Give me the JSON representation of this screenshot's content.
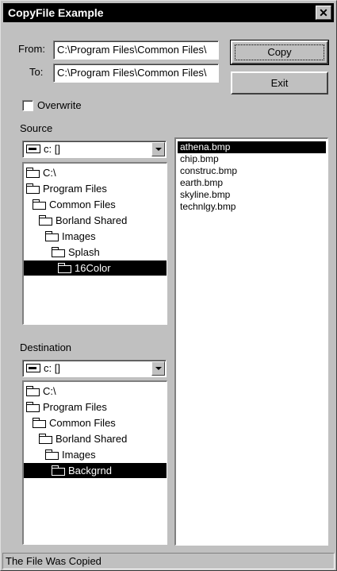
{
  "window": {
    "title": "CopyFile Example"
  },
  "title_controls": {
    "close_glyph": "✕"
  },
  "form": {
    "from_label": "From:",
    "from_value": "C:\\Program Files\\Common Files\\",
    "to_label": "To:",
    "to_value": "C:\\Program Files\\Common Files\\",
    "copy_label": "Copy",
    "exit_label": "Exit",
    "overwrite_label": "Overwrite",
    "overwrite_checked": false
  },
  "source": {
    "label": "Source",
    "drive": "c: []",
    "dirs": [
      {
        "name": "C:\\",
        "level": 0,
        "selected": false
      },
      {
        "name": "Program Files",
        "level": 0,
        "selected": false
      },
      {
        "name": "Common Files",
        "level": 1,
        "selected": false
      },
      {
        "name": "Borland Shared",
        "level": 2,
        "selected": false
      },
      {
        "name": "Images",
        "level": 3,
        "selected": false
      },
      {
        "name": "Splash",
        "level": 4,
        "selected": false
      },
      {
        "name": "16Color",
        "level": 5,
        "selected": true
      }
    ]
  },
  "destination": {
    "label": "Destination",
    "drive": "c: []",
    "dirs": [
      {
        "name": "C:\\",
        "level": 0,
        "selected": false
      },
      {
        "name": "Program Files",
        "level": 0,
        "selected": false
      },
      {
        "name": "Common Files",
        "level": 1,
        "selected": false
      },
      {
        "name": "Borland Shared",
        "level": 2,
        "selected": false
      },
      {
        "name": "Images",
        "level": 3,
        "selected": false
      },
      {
        "name": "Backgrnd",
        "level": 4,
        "selected": true
      }
    ]
  },
  "files": [
    {
      "name": "athena.bmp",
      "selected": true
    },
    {
      "name": "chip.bmp",
      "selected": false
    },
    {
      "name": "construc.bmp",
      "selected": false
    },
    {
      "name": "earth.bmp",
      "selected": false
    },
    {
      "name": "skyline.bmp",
      "selected": false
    },
    {
      "name": "technlgy.bmp",
      "selected": false
    }
  ],
  "status": {
    "text": "The File Was Copied"
  }
}
